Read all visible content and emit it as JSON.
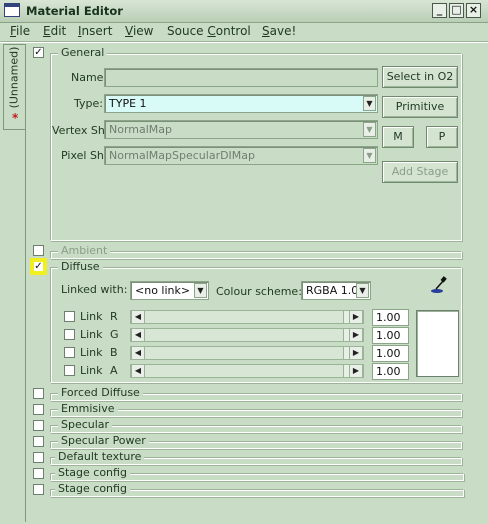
{
  "window": {
    "title": "Material  Editor",
    "controls": [
      "_",
      "□",
      "×"
    ]
  },
  "menu": [
    {
      "label": "File",
      "u": "F",
      "rest": "ile"
    },
    {
      "label": "Edit",
      "u": "E",
      "rest": "dit"
    },
    {
      "label": "Insert",
      "u": "I",
      "rest": "nsert"
    },
    {
      "label": "View",
      "u": "V",
      "rest": "iew"
    },
    {
      "label": "Souce Control",
      "pre": "Souce ",
      "u": "C",
      "rest": "ontrol"
    },
    {
      "label": "Save!",
      "u": "S",
      "rest": "ave!"
    }
  ],
  "side_tab": {
    "label": "(Unnamed)",
    "modified_marker": "*"
  },
  "general": {
    "title": "General",
    "checked": true,
    "name_label": "Name:",
    "name_value": "",
    "type_label": "Type:",
    "type_value": "TYPE 1",
    "vertex_label": "Vertex Sh:",
    "vertex_value": "NormalMap",
    "pixel_label": "Pixel Sh:",
    "pixel_value": "NormalMapSpecularDIMap",
    "select_btn": "Select in O2",
    "primitive_btn": "Primitive",
    "m_btn": "M",
    "p_btn": "P",
    "add_stage_btn": "Add Stage"
  },
  "ambient": {
    "title": "Ambient",
    "checked": false
  },
  "diffuse": {
    "title": "Diffuse",
    "checked": true,
    "linked_label": "Linked with:",
    "linked_value": "<no link>",
    "scheme_label": "Colour scheme:",
    "scheme_value": "RGBA 1.0",
    "link_label": "Link",
    "channels": [
      {
        "ch": "R",
        "value": "1.00"
      },
      {
        "ch": "G",
        "value": "1.00"
      },
      {
        "ch": "B",
        "value": "1.00"
      },
      {
        "ch": "A",
        "value": "1.00"
      }
    ],
    "swatch_color": "#ffffff"
  },
  "sections": [
    {
      "title": "Forced Diffuse"
    },
    {
      "title": "Emmisive"
    },
    {
      "title": "Specular"
    },
    {
      "title": "Specular Power"
    },
    {
      "title": "Default texture"
    },
    {
      "title": "Stage config"
    },
    {
      "title": "Stage config"
    }
  ]
}
